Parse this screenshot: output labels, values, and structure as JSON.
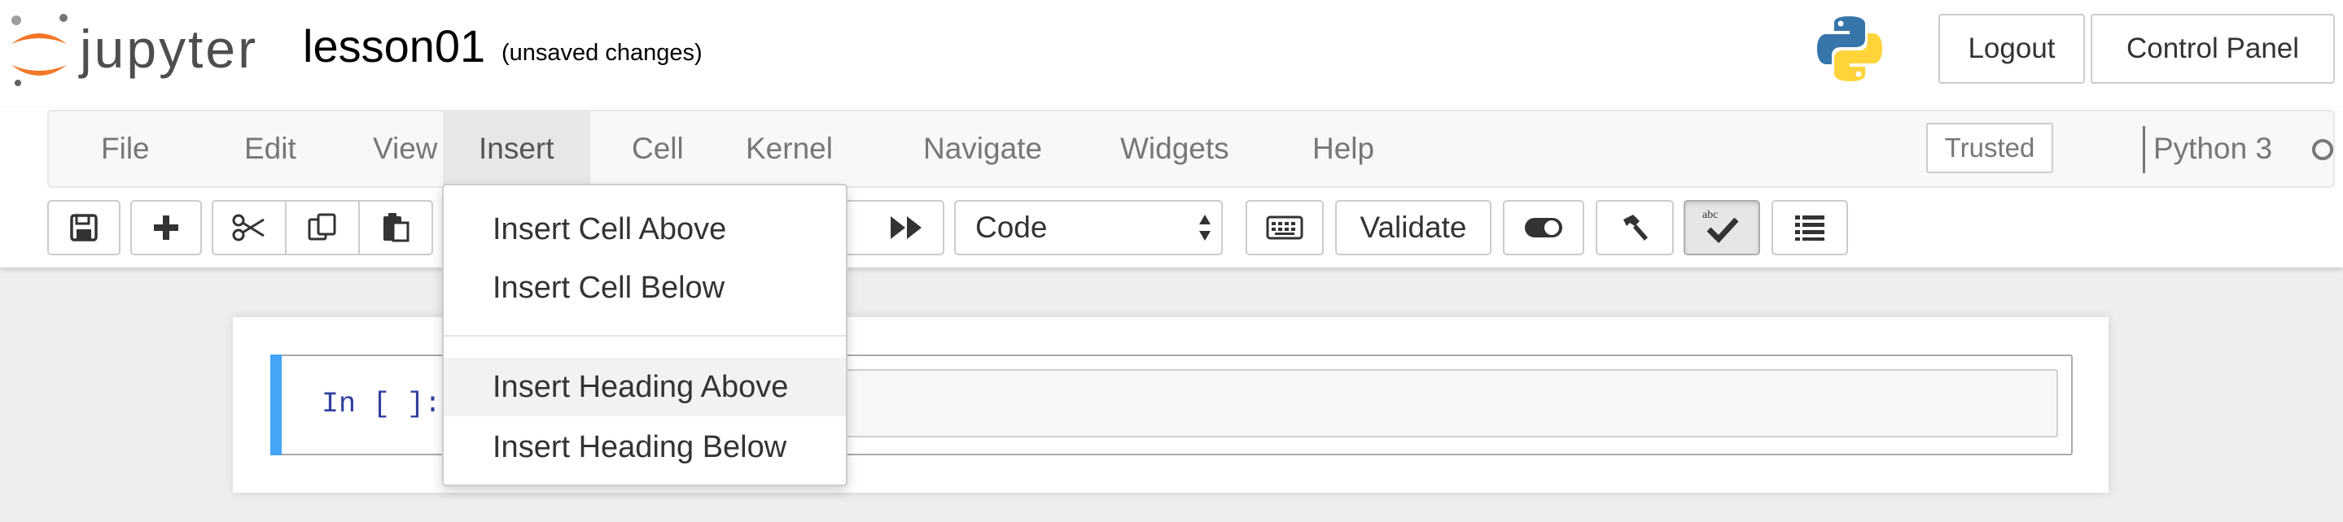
{
  "header": {
    "logo_text": "jupyter",
    "notebook_name": "lesson01",
    "save_status": "(unsaved changes)",
    "logout_label": "Logout",
    "control_panel_label": "Control Panel"
  },
  "menubar": {
    "items": [
      "File",
      "Edit",
      "View",
      "Insert",
      "Cell",
      "Kernel",
      "Navigate",
      "Widgets",
      "Help"
    ],
    "open_menu": "Insert",
    "trusted_label": "Trusted",
    "kernel_name": "Python 3"
  },
  "toolbar": {
    "buttons": [
      {
        "name": "save",
        "icon": "floppy-disk-icon"
      },
      {
        "name": "insert-cell-below",
        "icon": "plus-icon"
      },
      {
        "name": "cut",
        "icon": "scissors-icon"
      },
      {
        "name": "copy",
        "icon": "copy-icon"
      },
      {
        "name": "paste",
        "icon": "clipboard-icon"
      },
      {
        "name": "run-all",
        "icon": "fast-forward-icon"
      },
      {
        "name": "command-palette",
        "icon": "keyboard-icon"
      },
      {
        "name": "toggle",
        "icon": "toggle-icon"
      },
      {
        "name": "build",
        "icon": "hammer-icon"
      },
      {
        "name": "spellcheck",
        "icon": "abc-check-icon"
      },
      {
        "name": "table-of-contents",
        "icon": "list-icon"
      }
    ],
    "cell_type": "Code",
    "validate_label": "Validate",
    "spellcheck_label": "abc"
  },
  "insert_menu": {
    "items": [
      "Insert Cell Above",
      "Insert Cell Below",
      "Insert Heading Above",
      "Insert Heading Below"
    ],
    "highlighted": "Insert Heading Above"
  },
  "cell": {
    "prompt": "In [ ]:"
  },
  "colors": {
    "accent_blue": "#42a5f5",
    "prompt_blue": "#303f9f",
    "logo_orange": "#f37726"
  }
}
